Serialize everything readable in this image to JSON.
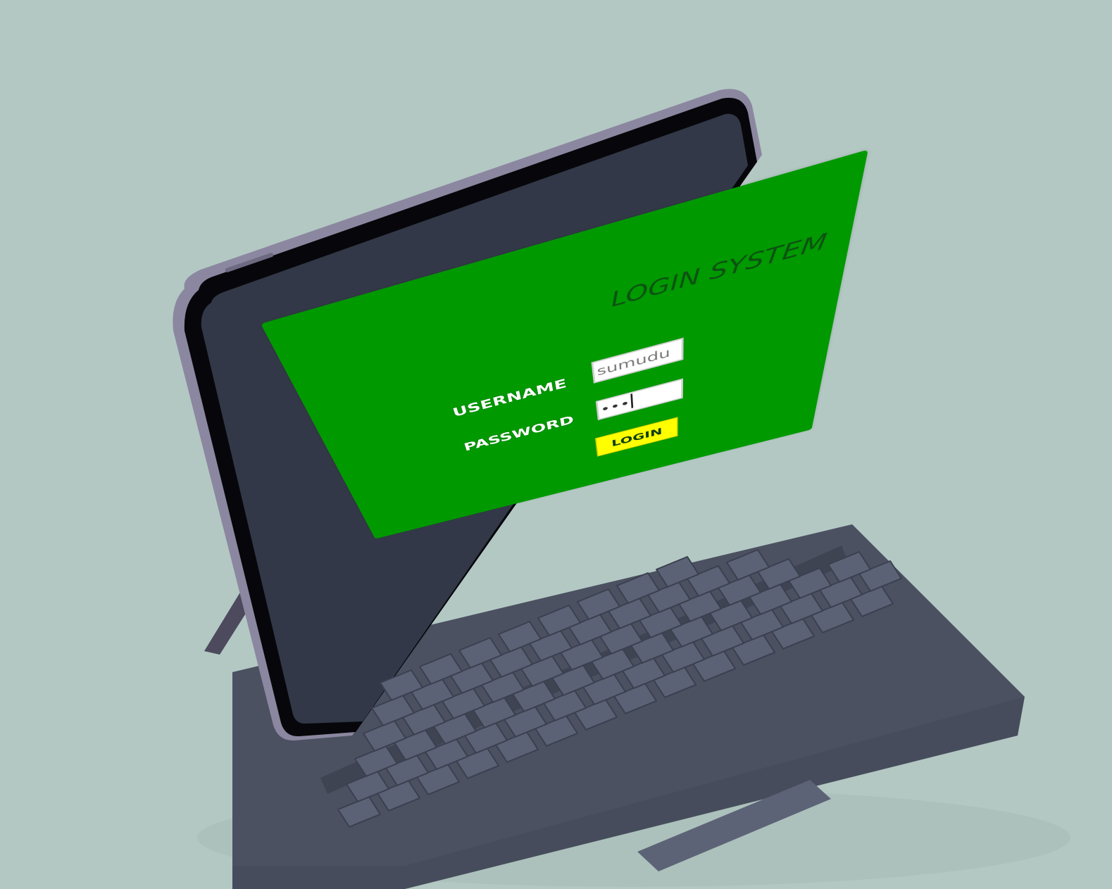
{
  "login_form": {
    "title": "LOGIN SYSTEM",
    "username_label": "USERNAME",
    "username_value": "sumudu",
    "password_label": "PASSWORD",
    "password_value_masked": "•••",
    "login_button_label": "LOGIN"
  },
  "colors": {
    "background": "#b3c8c3",
    "panel_green": "#009900",
    "title_text": "#0d5212",
    "label_text": "#ffffff",
    "button_yellow": "#ffff00",
    "keyboard_body": "#4a5060",
    "key_cap": "#5c6275",
    "tablet_frame": "#8f8aa0",
    "screen_dark": "#323847"
  },
  "icons": {
    "caret": "text-caret-icon"
  }
}
